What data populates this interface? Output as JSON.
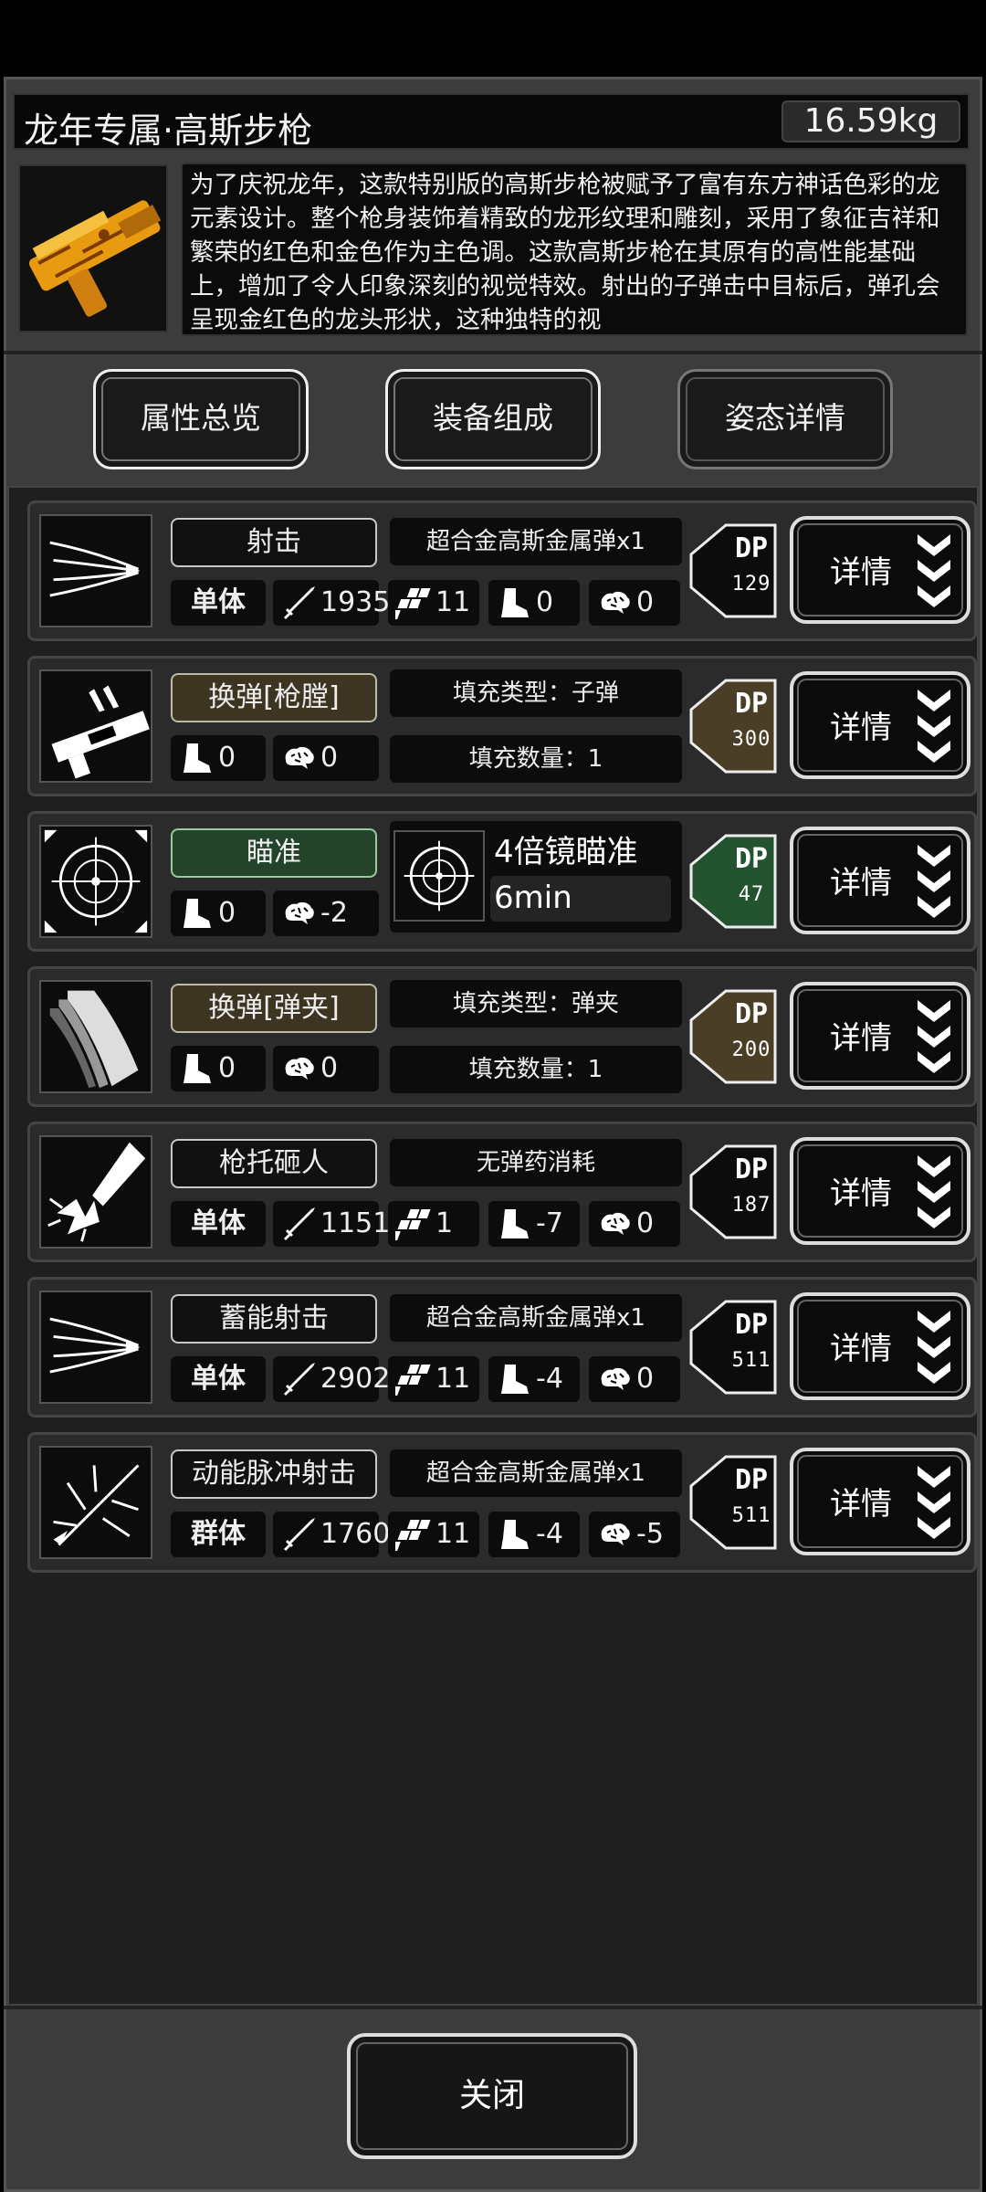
{
  "header": {
    "title": "龙年专属·高斯步枪",
    "weight": "16.59kg",
    "description": "为了庆祝龙年，这款特别版的高斯步枪被赋予了富有东方神话色彩的龙元素设计。整个枪身装饰着精致的龙形纹理和雕刻，采用了象征吉祥和繁荣的红色和金色作为主色调。这款高斯步枪在其原有的高性能基础上，增加了令人印象深刻的视觉特效。射出的子弹击中目标后，弹孔会呈现金红色的龙头形状，这种独特的视"
  },
  "tabs": [
    {
      "label": "属性总览"
    },
    {
      "label": "装备组成"
    },
    {
      "label": "姿态详情"
    }
  ],
  "detail_label": "详情",
  "dp_label": "DP",
  "close_label": "关闭",
  "colors": {
    "brown_name": "#3d3422",
    "green_name": "#23432b",
    "dp_brown": "#4a3e26",
    "dp_green": "#24542f"
  },
  "actions": [
    {
      "name": "射击",
      "icon": "shoot-icon",
      "target": "单体",
      "damage": "1935",
      "hit": "11",
      "move": "0",
      "stamina": "0",
      "info": "超合金高斯金属弹x1",
      "dp": "129"
    },
    {
      "name": "换弹[枪膛]",
      "icon": "reload-chamber-icon",
      "move": "0",
      "stamina": "0",
      "fill_type": "填充类型：子弹",
      "fill_count": "填充数量：1",
      "dp": "300"
    },
    {
      "name": "瞄准",
      "icon": "aim-icon",
      "move": "0",
      "stamina": "-2",
      "scope_title": "4倍镜瞄准",
      "scope_value": "6min",
      "dp": "47"
    },
    {
      "name": "换弹[弹夹]",
      "icon": "reload-magazine-icon",
      "move": "0",
      "stamina": "0",
      "fill_type": "填充类型：弹夹",
      "fill_count": "填充数量：1",
      "dp": "200"
    },
    {
      "name": "枪托砸人",
      "icon": "buttstroke-icon",
      "target": "单体",
      "damage": "1151",
      "hit": "1",
      "move": "-7",
      "stamina": "0",
      "info": "无弹药消耗",
      "dp": "187"
    },
    {
      "name": "蓄能射击",
      "icon": "charged-shot-icon",
      "target": "单体",
      "damage": "2902",
      "hit": "11",
      "move": "-4",
      "stamina": "0",
      "info": "超合金高斯金属弹x1",
      "dp": "511"
    },
    {
      "name": "动能脉冲射击",
      "icon": "pulse-shot-icon",
      "target": "群体",
      "damage": "1760",
      "hit": "11",
      "move": "-4",
      "stamina": "-5",
      "info": "超合金高斯金属弹x1",
      "dp": "511"
    }
  ]
}
